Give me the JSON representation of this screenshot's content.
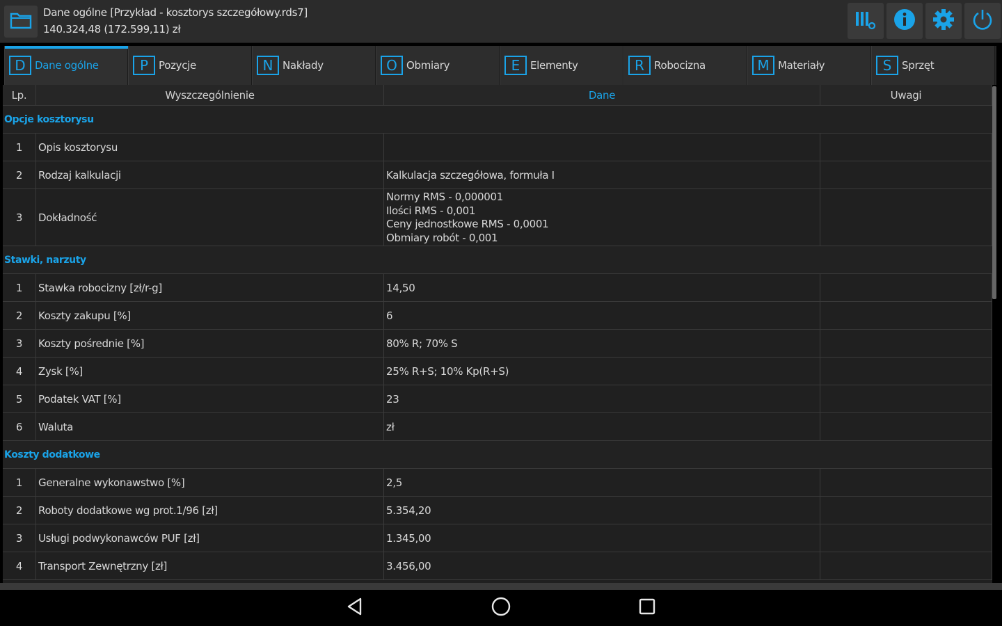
{
  "header": {
    "title": "Dane ogólne [Przykład - kosztorys szczegółowy.rds7]",
    "subtitle": "140.324,48 (172.599,11) zł"
  },
  "icons": {
    "folder": "folder-icon",
    "columns": "columns-settings-icon",
    "info": "info-icon",
    "settings": "gear-icon",
    "power": "power-icon"
  },
  "colors": {
    "accent": "#1aa3e8",
    "background": "#202020",
    "header": "#2b2b2b"
  },
  "tabs": [
    {
      "key": "D",
      "label": "Dane ogólne"
    },
    {
      "key": "P",
      "label": "Pozycje"
    },
    {
      "key": "N",
      "label": "Nakłady"
    },
    {
      "key": "O",
      "label": "Obmiary"
    },
    {
      "key": "E",
      "label": "Elementy"
    },
    {
      "key": "R",
      "label": "Robocizna"
    },
    {
      "key": "M",
      "label": "Materiały"
    },
    {
      "key": "S",
      "label": "Sprzęt"
    }
  ],
  "table": {
    "columns": {
      "lp": "Lp.",
      "wyszczegolnienie": "Wyszczególnienie",
      "dane": "Dane",
      "uwagi": "Uwagi"
    },
    "sections": [
      {
        "title": "Opcje kosztorysu",
        "rows": [
          {
            "lp": "1",
            "name": "Opis kosztorysu",
            "value": ""
          },
          {
            "lp": "2",
            "name": "Rodzaj kalkulacji",
            "value": "Kalkulacja szczegółowa, formuła I"
          },
          {
            "lp": "3",
            "name": "Dokładność",
            "lines": [
              "Normy RMS - 0,000001",
              "Ilości RMS - 0,001",
              "Ceny jednostkowe RMS - 0,0001",
              "Obmiary robót - 0,001"
            ]
          }
        ]
      },
      {
        "title": "Stawki, narzuty",
        "rows": [
          {
            "lp": "1",
            "name": "Stawka robocizny [zł/r-g]",
            "value": "14,50"
          },
          {
            "lp": "2",
            "name": "Koszty zakupu [%]",
            "value": "6"
          },
          {
            "lp": "3",
            "name": "Koszty pośrednie [%]",
            "value": "80% R; 70% S"
          },
          {
            "lp": "4",
            "name": "Zysk [%]",
            "value": "25% R+S; 10% Kp(R+S)"
          },
          {
            "lp": "5",
            "name": "Podatek VAT [%]",
            "value": "23"
          },
          {
            "lp": "6",
            "name": "Waluta",
            "value": "zł"
          }
        ]
      },
      {
        "title": "Koszty dodatkowe",
        "rows": [
          {
            "lp": "1",
            "name": "Generalne wykonawstwo [%]",
            "value": "2,5"
          },
          {
            "lp": "2",
            "name": "Roboty dodatkowe wg prot.1/96 [zł]",
            "value": "5.354,20"
          },
          {
            "lp": "3",
            "name": "Usługi podwykonawców PUF [zł]",
            "value": "1.345,00"
          },
          {
            "lp": "4",
            "name": "Transport Zewnętrzny [zł]",
            "value": "3.456,00"
          }
        ]
      }
    ]
  },
  "navbar": {
    "back": "back-icon",
    "home": "home-icon",
    "recents": "recents-icon"
  }
}
